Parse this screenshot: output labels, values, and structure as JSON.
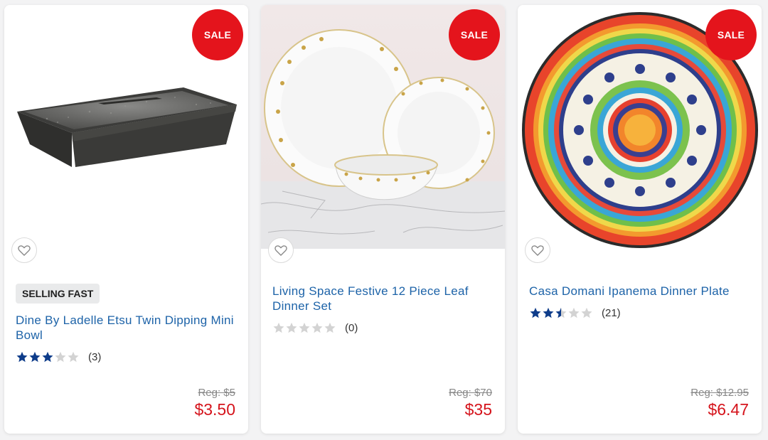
{
  "products": [
    {
      "badge": "SALE",
      "flag": "SELLING FAST",
      "title": "Dine By Ladelle Etsu Twin Dipping Mini Bowl",
      "rating": 3,
      "reviews": "(3)",
      "reg_price": "Reg: $5",
      "sale_price": "$3.50"
    },
    {
      "badge": "SALE",
      "flag": "",
      "title": "Living Space Festive 12 Piece Leaf Dinner Set",
      "rating": 0,
      "reviews": "(0)",
      "reg_price": "Reg: $70",
      "sale_price": "$35"
    },
    {
      "badge": "SALE",
      "flag": "",
      "title": "Casa Domani Ipanema Dinner Plate",
      "rating": 2.5,
      "reviews": "(21)",
      "reg_price": "Reg: $12.95",
      "sale_price": "$6.47"
    }
  ],
  "colors": {
    "sale_red": "#e4141c",
    "price_red": "#d5141c",
    "title_blue": "#1d63a8",
    "star_blue": "#0e3c8a",
    "star_empty": "#d3d3d3"
  },
  "icons": [
    "heart-outline-icon",
    "star-icon"
  ]
}
